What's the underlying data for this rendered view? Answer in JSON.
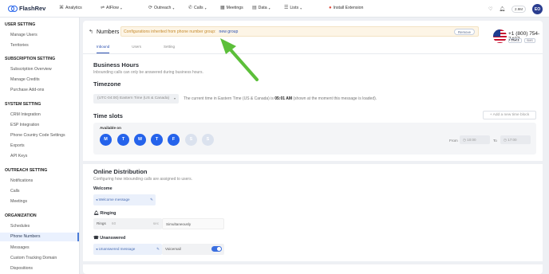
{
  "app": {
    "name": "FlashRev"
  },
  "topnav": {
    "items": [
      {
        "label": "Analytics",
        "icon": "analytics-icon"
      },
      {
        "label": "AIFlow",
        "icon": "aiflow-icon"
      },
      {
        "label": "Outreach",
        "icon": "outreach-icon"
      },
      {
        "label": "Calls",
        "icon": "phone-icon"
      },
      {
        "label": "Meetings",
        "icon": "calendar-icon"
      },
      {
        "label": "Data",
        "icon": "data-icon"
      },
      {
        "label": "Lists",
        "icon": "list-icon"
      }
    ],
    "extension": "Install Extension",
    "balance": "2.9M",
    "avatar_initials": "EO"
  },
  "sidebar": {
    "sections": [
      {
        "title": "USER SETTING",
        "items": [
          "Manage Users",
          "Territories"
        ]
      },
      {
        "title": "SUBSCRIPTION SETTING",
        "items": [
          "Subscription Overview",
          "Manage Credits",
          "Purchase Add-ons"
        ]
      },
      {
        "title": "SYSTEM SETTING",
        "items": [
          "CRM Integration",
          "ESP Integration",
          "Phone Country Code Settings",
          "Exports",
          "API Keys"
        ]
      },
      {
        "title": "OUTREACH SETTING",
        "items": [
          "Notifications",
          "Calls",
          "Meetings"
        ]
      },
      {
        "title": "ORGANIZATION",
        "items": [
          "Schedules",
          "Phone Numbers",
          "Messages",
          "Custom Tracking Domain",
          "Dispositions"
        ]
      }
    ],
    "active": "Phone Numbers"
  },
  "header": {
    "back_icon": "back-arrow-icon",
    "title": "Numbers",
    "banner_text": "Configurations inherited from phone number group:",
    "banner_link": "new group",
    "remove_label": "Remove",
    "phone": "+1 (800) 754-7437",
    "tags": [
      "VOICE",
      "SMS"
    ],
    "tabs": [
      "Inbound",
      "Users",
      "Setting"
    ],
    "active_tab": "Inbound"
  },
  "business_hours": {
    "title": "Business Hours",
    "desc": "Inbounding calls can only be answered during business hours."
  },
  "timezone": {
    "title": "Timezone",
    "value": "(UTC-04:00) Eastern Time (US & Canada)",
    "note_prefix": "The current time in Eastern Time (US & Canada) is",
    "note_time": "05:01 AM",
    "note_suffix": "(shown at the moment this message is loaded)."
  },
  "time_slots": {
    "title": "Time slots",
    "add_label": "+ Add a new time block",
    "available_label": "Available on",
    "days": [
      {
        "label": "M",
        "active": true
      },
      {
        "label": "T",
        "active": true
      },
      {
        "label": "W",
        "active": true
      },
      {
        "label": "T",
        "active": true
      },
      {
        "label": "F",
        "active": true
      },
      {
        "label": "S",
        "active": false
      },
      {
        "label": "S",
        "active": false
      }
    ],
    "from_label": "From",
    "from_value": "10:00",
    "to_label": "To",
    "to_value": "17:00"
  },
  "online_distribution": {
    "title": "Online Distribution",
    "desc": "Configuring how inbounding calls are assigned to users.",
    "welcome_label": "Welcome",
    "welcome_msg": "Welcome message",
    "ringing_label": "Ringing",
    "rings_label": "Rings",
    "rings_value": "60",
    "rings_unit": "sec",
    "ring_mode": "Simultaneously",
    "unanswered_label": "Unanswered",
    "unanswered_msg": "Unanswered message",
    "voicemail_label": "Voicemail",
    "voicemail_on": true
  },
  "colors": {
    "accent": "#2563eb",
    "banner_bg": "#fdf5e6",
    "arrow": "#5cbf3a"
  }
}
